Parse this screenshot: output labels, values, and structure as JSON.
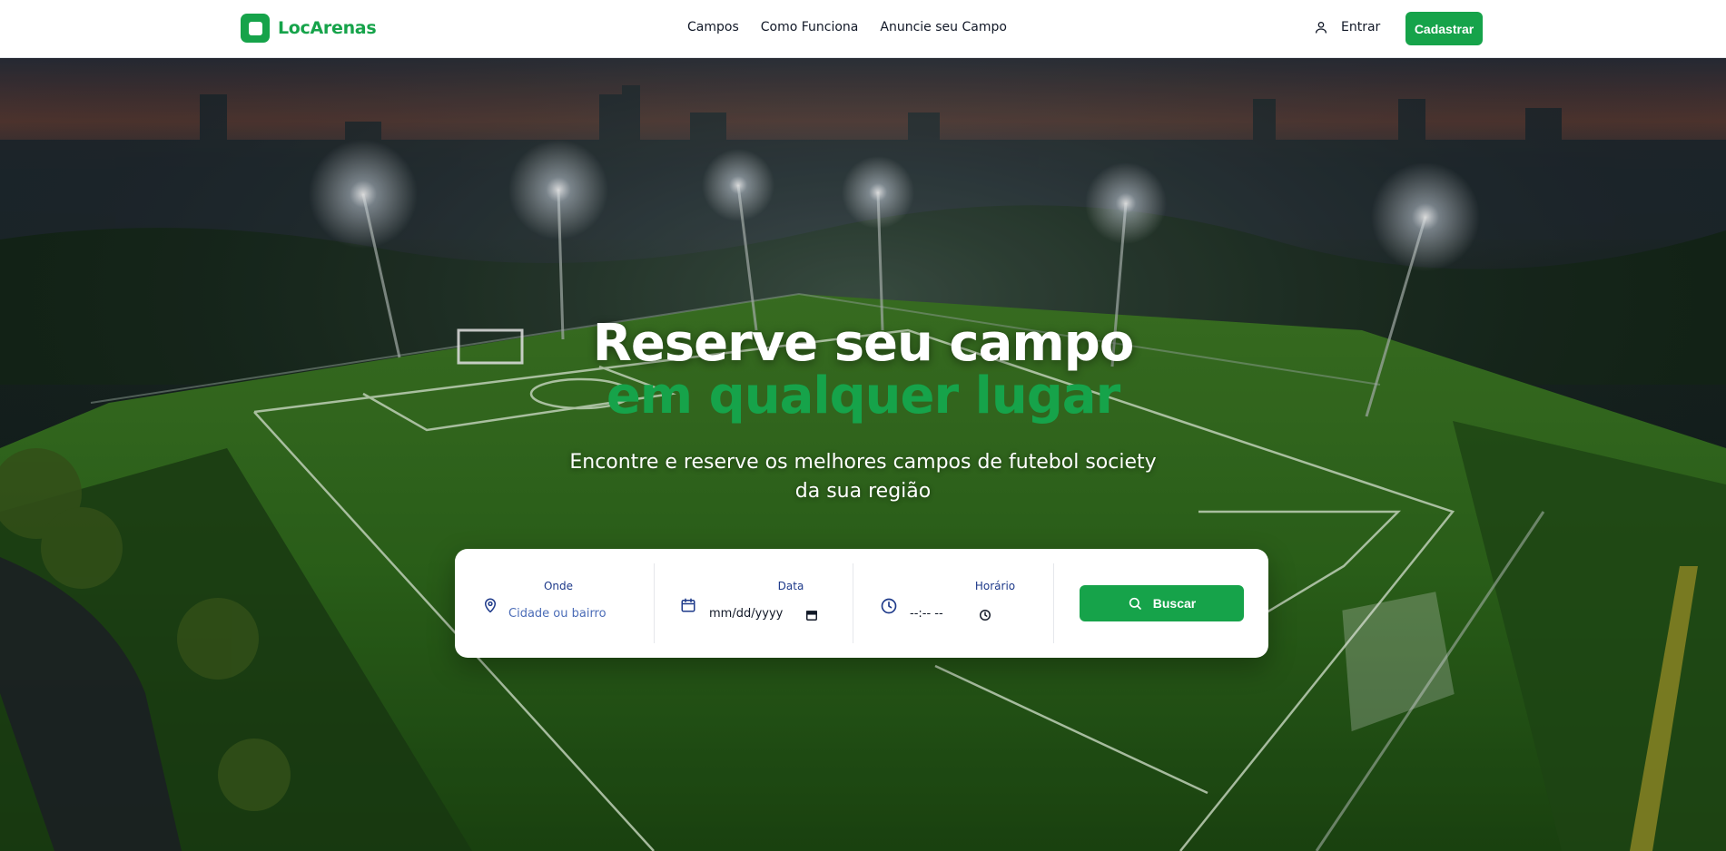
{
  "brand": {
    "name": "LocArenas",
    "color": "#16a34a"
  },
  "nav": {
    "items": [
      "Campos",
      "Como Funciona",
      "Anuncie seu Campo"
    ]
  },
  "auth": {
    "login_label": "Entrar",
    "signup_label": "Cadastrar"
  },
  "hero": {
    "title_line1": "Reserve seu campo",
    "title_line2": "em qualquer lugar",
    "subtitle": "Encontre e reserve os melhores campos de futebol society da sua região",
    "background": "aerial football field at dusk with floodlights"
  },
  "search": {
    "where": {
      "label": "Onde",
      "placeholder": "Cidade ou bairro",
      "icon": "map-pin-icon"
    },
    "date": {
      "label": "Data",
      "value": "mm/dd/yyyy",
      "icon": "calendar-icon"
    },
    "time": {
      "label": "Horário",
      "value": "--:-- --",
      "icon": "clock-icon"
    },
    "button_label": "Buscar",
    "button_icon": "search-icon"
  }
}
